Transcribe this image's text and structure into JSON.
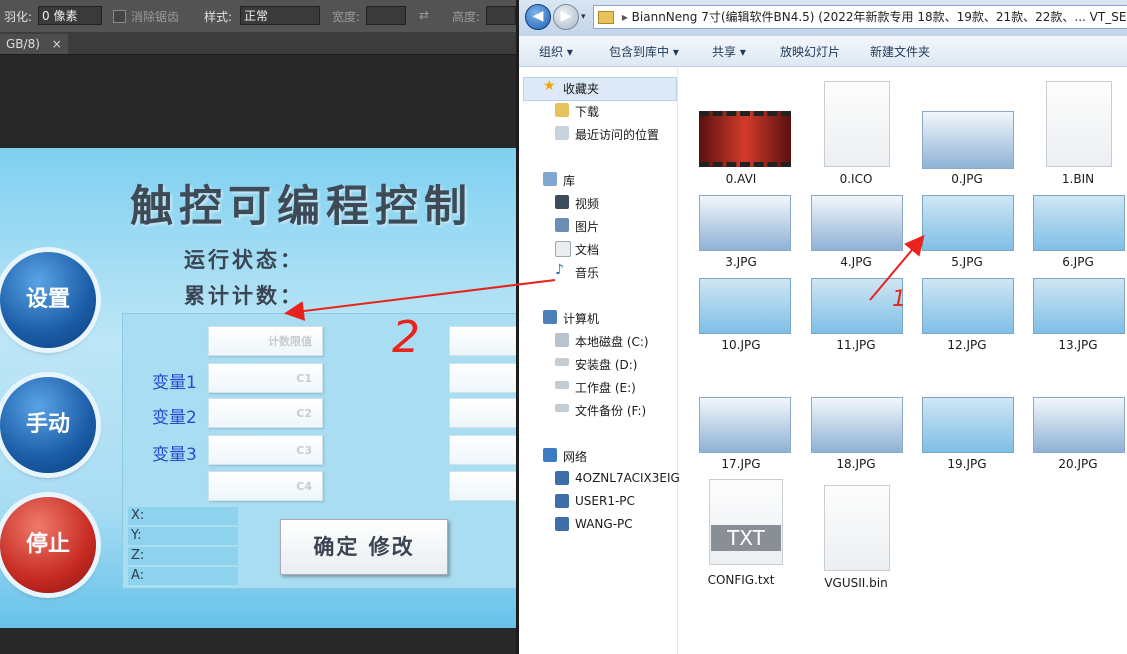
{
  "photoshop": {
    "options": {
      "feather_label": "羽化:",
      "feather_value": "0 像素",
      "antialias_label": "消除锯齿",
      "style_label": "样式:",
      "style_value": "正常",
      "width_label": "宽度:",
      "height_label": "高度:"
    },
    "tab_label": "GB/8)",
    "tab_close": "×",
    "hmi": {
      "title": "触控可编程控制",
      "run_status": "运行状态：",
      "total_count": "累计计数：",
      "btn_settings": "设置",
      "btn_manual": "手动",
      "btn_stop": "停止",
      "box_limit": "计数限值",
      "box_c1": "C1",
      "box_c2": "C2",
      "box_c3": "C3",
      "box_c4": "C4",
      "var1": "变量1",
      "var2": "变量2",
      "var3": "变量3",
      "x": "X:",
      "y": "Y:",
      "z": "Z:",
      "a": "A:",
      "confirm": "确定 修改"
    }
  },
  "explorer": {
    "address": "BiannNeng 7寸(编辑软件BN4.5) (2022年新款专用 18款、19款、21款、22款、...  VT_SE",
    "toolbar": {
      "organize": "组织 ▾",
      "include": "包含到库中 ▾",
      "share": "共享 ▾",
      "slideshow": "放映幻灯片",
      "new_folder": "新建文件夹"
    },
    "nav": {
      "favorites": "收藏夹",
      "downloads": "下载",
      "recent": "最近访问的位置",
      "library": "库",
      "video": "视频",
      "pictures": "图片",
      "documents": "文档",
      "music": "音乐",
      "computer": "计算机",
      "drive_c": "本地磁盘 (C:)",
      "drive_d": "安装盘 (D:)",
      "drive_e": "工作盘 (E:)",
      "drive_f": "文件备份 (F:)",
      "network": "网络",
      "pc1": "4OZNL7ACIX3EIG",
      "pc2": "USER1-PC",
      "pc3": "WANG-PC"
    },
    "files": [
      "0.AVI",
      "0.ICO",
      "0.JPG",
      "1.BIN",
      "3.JPG",
      "4.JPG",
      "5.JPG",
      "6.JPG",
      "10.JPG",
      "11.JPG",
      "12.JPG",
      "13.JPG",
      "17.JPG",
      "18.JPG",
      "19.JPG",
      "20.JPG",
      "CONFIG.txt",
      "VGUSII.bin"
    ],
    "txt_badge": "TXT"
  },
  "annotations": {
    "handwritten_2": "2",
    "handwritten_1": "1",
    "arrow_color": "#e8231c"
  }
}
